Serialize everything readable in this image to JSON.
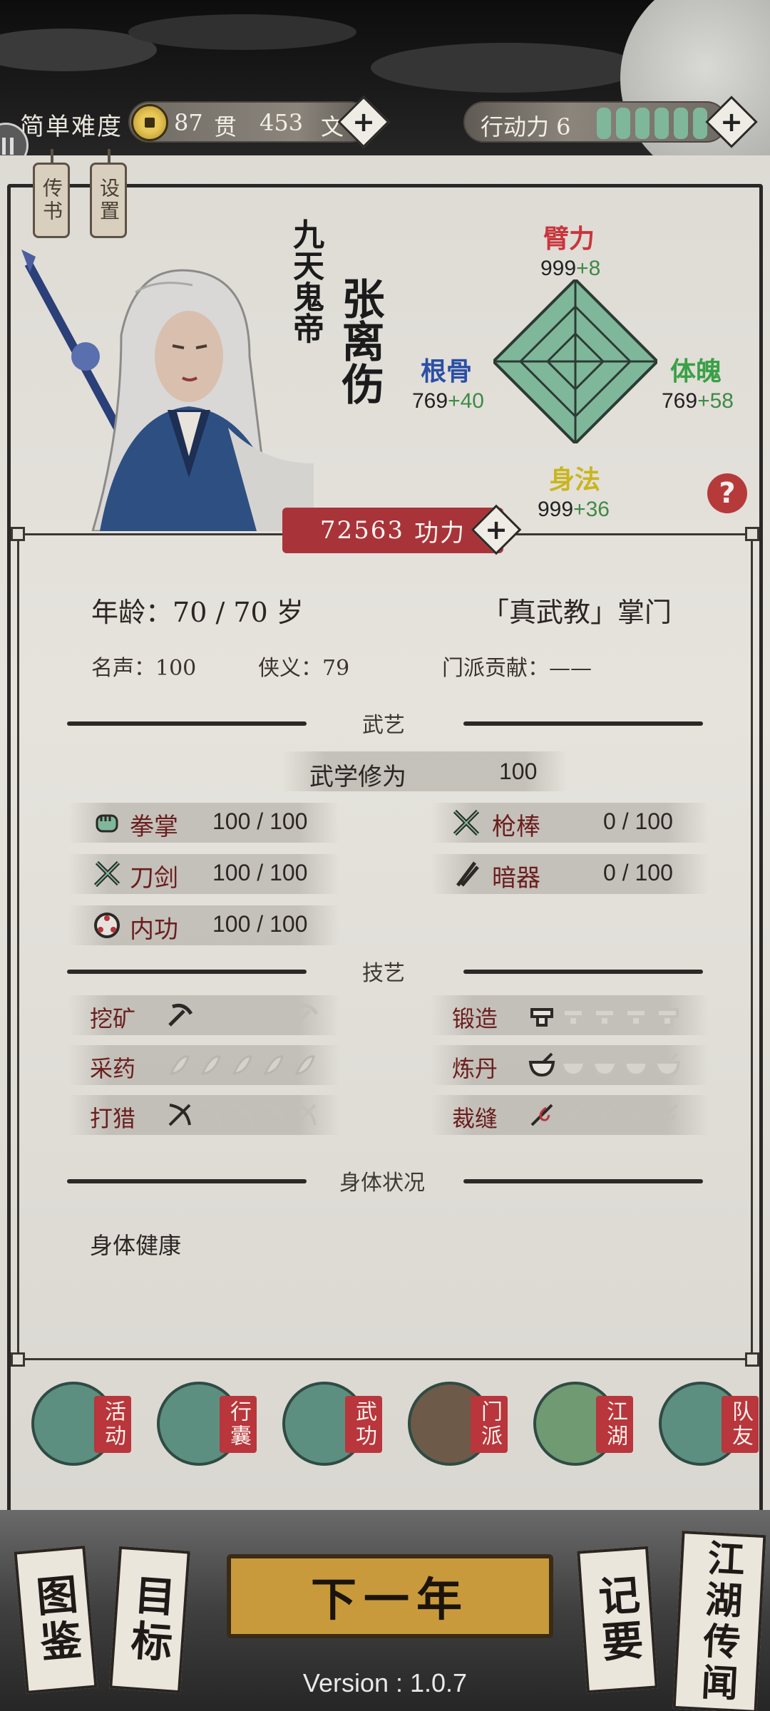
{
  "topbar": {
    "difficulty": "简单难度",
    "guan_value": "87",
    "guan_unit": "贯",
    "wen_value": "453",
    "wen_unit": "文",
    "action_label": "行动力 6",
    "action_points": 6,
    "plus_symbol": "+"
  },
  "tags": {
    "letters": "传书",
    "settings": "设置"
  },
  "character": {
    "title": "九天鬼帝",
    "name": "张离伤",
    "power_value": "72563",
    "power_label": "功力",
    "stats": {
      "strength": {
        "name": "臂力",
        "base": "999",
        "bonus": "+8"
      },
      "root": {
        "name": "根骨",
        "base": "769",
        "bonus": "+40"
      },
      "physique": {
        "name": "体魄",
        "base": "769",
        "bonus": "+58"
      },
      "agility": {
        "name": "身法",
        "base": "999",
        "bonus": "+36"
      }
    },
    "help_symbol": "?"
  },
  "info": {
    "age_label": "年龄：",
    "age_value": "70 / 70 岁",
    "sect_role": "「真武教」掌门",
    "fame_label": "名声：",
    "fame_value": "100",
    "chivalry_label": "侠义：",
    "chivalry_value": "79",
    "contribution_label": "门派贡献：",
    "contribution_value": "——"
  },
  "martial": {
    "section_title": "武艺",
    "cultivation_label": "武学修为",
    "cultivation_value": "100",
    "skills": [
      {
        "name": "拳掌",
        "value": "100 / 100",
        "icon": "fist-icon"
      },
      {
        "name": "枪棒",
        "value": "0 / 100",
        "icon": "spear-icon"
      },
      {
        "name": "刀剑",
        "value": "100 / 100",
        "icon": "sword-icon"
      },
      {
        "name": "暗器",
        "value": "0 / 100",
        "icon": "dart-icon"
      },
      {
        "name": "内功",
        "value": "100 / 100",
        "icon": "inner-power-icon"
      }
    ]
  },
  "crafts": {
    "section_title": "技艺",
    "items": [
      {
        "name": "挖矿",
        "level": 1,
        "max": 5,
        "icon": "pickaxe-icon"
      },
      {
        "name": "锻造",
        "level": 1,
        "max": 5,
        "icon": "anvil-icon"
      },
      {
        "name": "采药",
        "level": 0,
        "max": 5,
        "icon": "herb-icon"
      },
      {
        "name": "炼丹",
        "level": 1,
        "max": 5,
        "icon": "mortar-icon"
      },
      {
        "name": "打猎",
        "level": 1,
        "max": 5,
        "icon": "bow-icon"
      },
      {
        "name": "裁缝",
        "level": 1,
        "max": 5,
        "icon": "needle-icon"
      }
    ]
  },
  "health": {
    "section_title": "身体状况",
    "status": "身体健康"
  },
  "nav": [
    {
      "label": "活动",
      "icon": "gourd-icon"
    },
    {
      "label": "行囊",
      "icon": "bag-icon"
    },
    {
      "label": "武功",
      "icon": "scroll-icon"
    },
    {
      "label": "门派",
      "icon": "temple-icon"
    },
    {
      "label": "江湖",
      "icon": "mountain-icon"
    },
    {
      "label": "队友",
      "icon": "banner-icon"
    }
  ],
  "footer": {
    "atlas": "图鉴",
    "goals": "目标",
    "next_year": "下一年",
    "notes": "记要",
    "rumors": "江湖传闻",
    "version": "Version : 1.0.7"
  },
  "colors": {
    "accent_red": "#a8343a",
    "bonus_green": "#3f8a45",
    "energy_green": "#7fb79a",
    "gold_button": "#c99a3c"
  }
}
